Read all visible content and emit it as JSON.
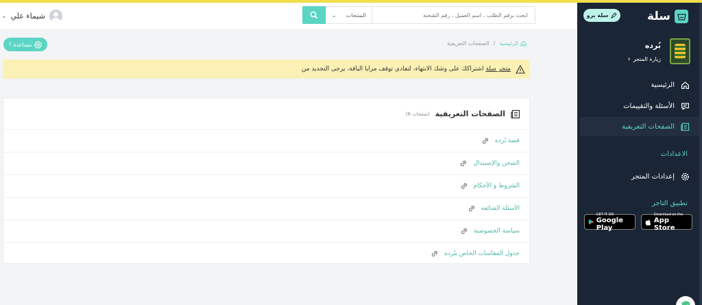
{
  "header": {
    "user_name": "شيماء علي",
    "search_placeholder": "ابحث برقم الطلب ، اسم العميل ، رقم الشحنة",
    "search_category": "المنتجات"
  },
  "help_button": "مساعدة ؟",
  "breadcrumb": {
    "home": "الرئيسية",
    "separator": "/",
    "current": "الصفحات التعريفية"
  },
  "alert": {
    "text": "اشتراكك على وشك الانتهاء، لتفادي توقف مزايا الباقة، يرجى التجديد من",
    "link": "متجر سلة"
  },
  "card": {
    "title": "الصفحات التعريفية",
    "count": "(6 صفحات)",
    "pages": [
      "قصة بُرده",
      "الشحن والإستبدال",
      "الشروط و الأحكام",
      "الأسئلة الشائعة",
      "سياسة الخصوصية",
      "جدول المقاسات الخاص ببُرده"
    ]
  },
  "sidebar": {
    "logo_text": "سلة",
    "pro_label": "سلة برو",
    "store_name": "بُرده",
    "visit_store": "زيارة المتجر",
    "nav": {
      "home": "الرئيسية",
      "reviews": "الأسئلة والتقييمات",
      "pages": "الصفحات التعريفية"
    },
    "settings_title": "الاعدادات",
    "store_settings": "إعدادات المتجر",
    "merchant_app_title": "تطبيق التاجر",
    "google_play_small": "GET IT ON",
    "google_play_big": "Google Play",
    "app_store_small": "Download on the",
    "app_store_big": "App Store"
  },
  "colors": {
    "accent": "#5dd5c4",
    "sidebar_bg": "#1a2535",
    "alert_bg": "#fbf1b5",
    "top_stripe": "#f2dd4a"
  }
}
